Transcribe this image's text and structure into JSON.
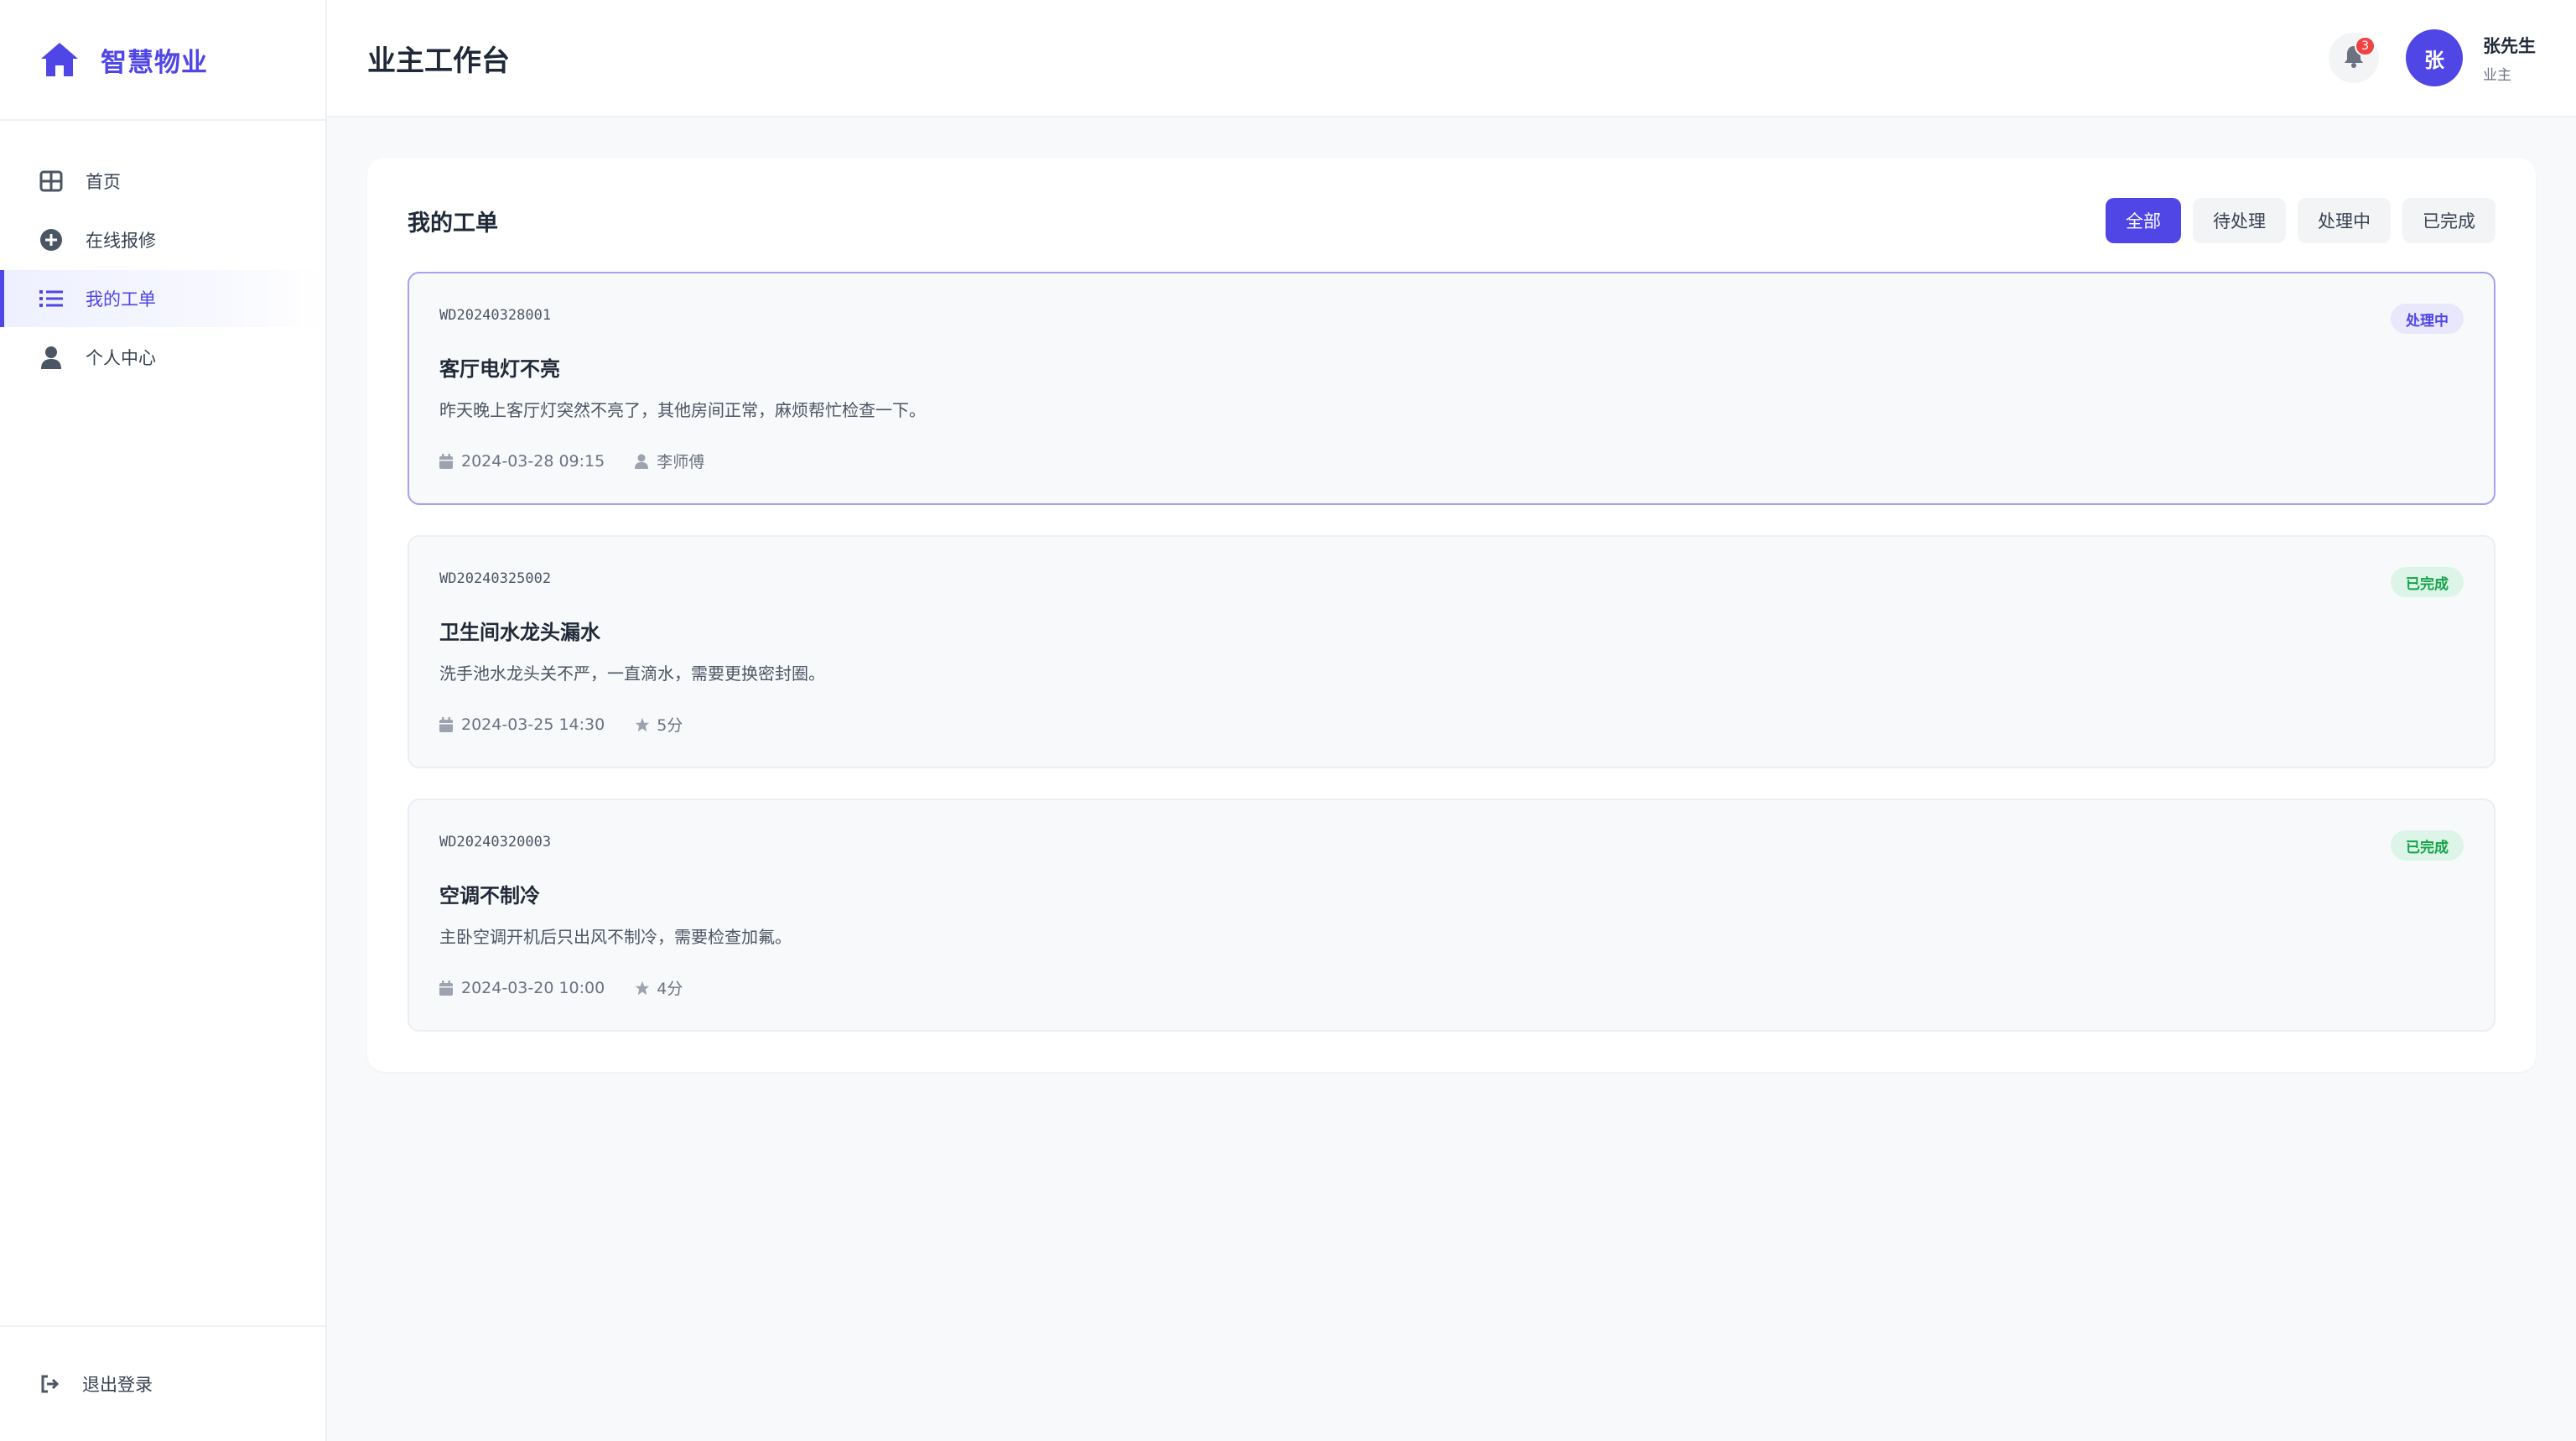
{
  "brand": {
    "name": "智慧物业"
  },
  "sidebar": {
    "items": [
      {
        "label": "首页",
        "icon": "grid-icon"
      },
      {
        "label": "在线报修",
        "icon": "plus-circle-icon"
      },
      {
        "label": "我的工单",
        "icon": "list-icon",
        "active": true
      },
      {
        "label": "个人中心",
        "icon": "user-icon"
      }
    ],
    "logout_label": "退出登录"
  },
  "header": {
    "title": "业主工作台",
    "notification_count": "3",
    "user": {
      "avatar_text": "张",
      "name": "张先生",
      "role": "业主"
    }
  },
  "orders_panel": {
    "title": "我的工单",
    "filters": [
      {
        "label": "全部",
        "active": true
      },
      {
        "label": "待处理",
        "active": false
      },
      {
        "label": "处理中",
        "active": false
      },
      {
        "label": "已完成",
        "active": false
      }
    ],
    "orders": [
      {
        "order_no": "WD20240328001",
        "status": "处理中",
        "title": "客厅电灯不亮",
        "description": "昨天晚上客厅灯突然不亮了，其他房间正常，麻烦帮忙检查一下。",
        "date": "2024-03-28 09:15",
        "extra": "李师傅",
        "extra_icon": "user-icon"
      },
      {
        "order_no": "WD20240325002",
        "status": "已完成",
        "title": "卫生间水龙头漏水",
        "description": "洗手池水龙头关不严，一直滴水，需要更换密封圈。",
        "date": "2024-03-25 14:30",
        "extra": "5分",
        "extra_icon": "star-icon"
      },
      {
        "order_no": "WD20240320003",
        "status": "已完成",
        "title": "空调不制冷",
        "description": "主卧空调开机后只出风不制冷，需要检查加氟。",
        "date": "2024-03-20 10:00",
        "extra": "4分",
        "extra_icon": "star-icon"
      }
    ]
  },
  "colors": {
    "accent": "#4f46e5",
    "badge_red": "#ef4444",
    "status_done": "#16a34a"
  }
}
